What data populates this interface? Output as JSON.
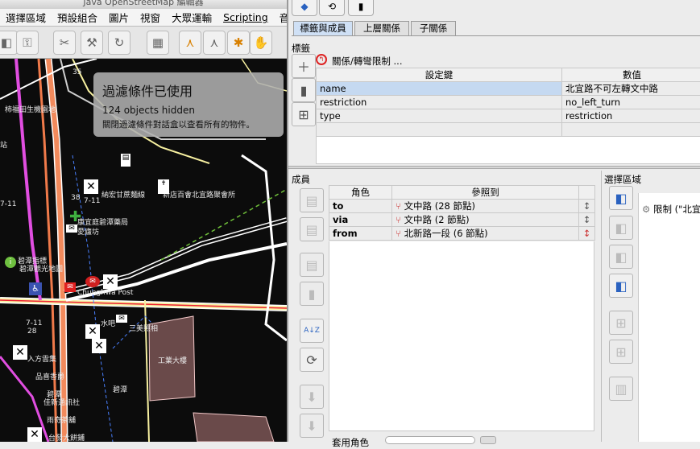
{
  "window": {
    "title": "Java OpenStreetMap 編輯器"
  },
  "menu": [
    "選擇區域",
    "預設組合",
    "圖片",
    "視窗",
    "大眾運輸",
    "Scripting",
    "音效"
  ],
  "map_labels": [
    {
      "text": "35"
    },
    {
      "text": "柿福田生機園地"
    },
    {
      "text": "站"
    },
    {
      "text": "7-11"
    },
    {
      "text": "納宏甘蔗麵線"
    },
    {
      "text": "新店百會北宜路聚會所"
    },
    {
      "text": "康宜庭碧潭藥局"
    },
    {
      "text": "愛廬坊"
    },
    {
      "text": "碧潭指標"
    },
    {
      "text": "碧潭觀光地圖"
    },
    {
      "text": "Chunghwa Post"
    },
    {
      "text": "7-11"
    },
    {
      "text": "28"
    },
    {
      "text": "水吧"
    },
    {
      "text": "三美照相"
    },
    {
      "text": "工業大樓"
    },
    {
      "text": "入方雲集"
    },
    {
      "text": "品喜香爵"
    },
    {
      "text": "碧潭"
    },
    {
      "text": "佳新通訊社"
    },
    {
      "text": "碧潭"
    },
    {
      "text": "雨奇茶舖"
    },
    {
      "text": "台發大餅鋪"
    },
    {
      "text": "38"
    },
    {
      "text": "7-11"
    }
  ],
  "filter_overlay": {
    "title": "過濾條件已使用",
    "count": "124 objects hidden",
    "hint": "關閉過濾條件對話盒以查看所有的物件。"
  },
  "tabs": [
    "標籤與成員",
    "上層關係",
    "子關係"
  ],
  "tags_section": {
    "label": "標籤",
    "relation_title": "關係/轉彎限制 ...",
    "col_key": "設定鍵",
    "col_value": "數值",
    "rows": [
      {
        "key": "name",
        "value": "北宜路不可左轉文中路"
      },
      {
        "key": "restriction",
        "value": "no_left_turn"
      },
      {
        "key": "type",
        "value": "restriction"
      }
    ]
  },
  "members_section": {
    "label": "成員",
    "col_role": "角色",
    "col_ref": "參照到",
    "rows": [
      {
        "role": "to",
        "ref": "文中路 (28 節點)"
      },
      {
        "role": "via",
        "ref": "文中路 (2 節點)"
      },
      {
        "role": "from",
        "ref": "北新路一段 (6 節點)"
      }
    ],
    "role_label": "套用角色"
  },
  "selection_section": {
    "label": "選擇區域",
    "item": "限制 (\"北宜"
  },
  "colors": {
    "tab_active": "#cfe0f5",
    "selection_highlight": "#c5d9f1",
    "map_bg": "#0c0c0c",
    "filter_bg": "#afafaf"
  }
}
